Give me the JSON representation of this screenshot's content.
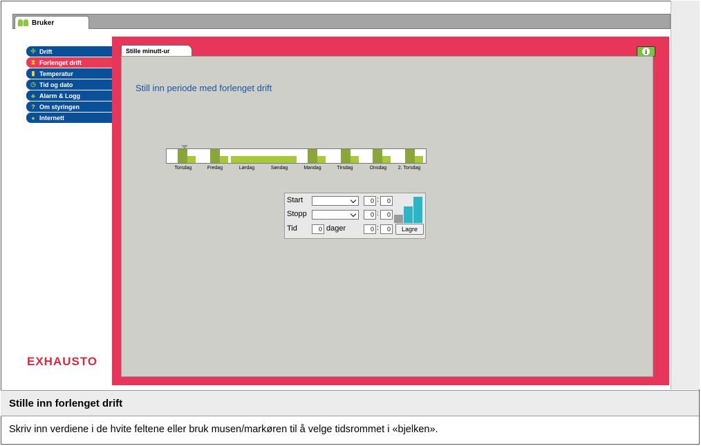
{
  "window": {
    "tab_label": "Bruker"
  },
  "sidebar": {
    "items": [
      {
        "label": "Drift",
        "icon": "fan-icon"
      },
      {
        "label": "Forlenget drift",
        "icon": "hourglass-icon"
      },
      {
        "label": "Temperatur",
        "icon": "thermometer-icon"
      },
      {
        "label": "Tid og dato",
        "icon": "clock-icon"
      },
      {
        "label": "Alarm & Logg",
        "icon": "bell-icon"
      },
      {
        "label": "Om styringen",
        "icon": "question-icon"
      },
      {
        "label": "Internett",
        "icon": "globe-icon"
      }
    ],
    "active_index": 1
  },
  "logo": "EXHAUSTO",
  "panel": {
    "tab_label": "Stille minutt-ur",
    "heading": "Still inn periode med forlenget drift"
  },
  "timeline": {
    "days": [
      "Torsdag",
      "Fredag",
      "Lørdag",
      "Søndag",
      "Mandag",
      "Tirsdag",
      "Onsdag",
      "2. Torsdag"
    ]
  },
  "form": {
    "start_label": "Start",
    "stopp_label": "Stopp",
    "tid_label": "Tid",
    "start_hour": "0",
    "start_min": "0",
    "stopp_hour": "0",
    "stopp_min": "0",
    "tid_days": "0",
    "dager_label": "dager",
    "tid_hour": "0",
    "tid_min": "0",
    "colon": ":",
    "save_label": "Lagre"
  },
  "colors": {
    "nav_blue": "#0a4f9a",
    "nav_active": "#ea3a5a",
    "panel_red": "#e8365b",
    "bar_green": "#a6c839",
    "bar_dark": "#8aa63a",
    "level_cyan": "#2bb6c6"
  },
  "footer": {
    "title": "Stille inn forlenget drift",
    "text": "Skriv inn verdiene i de hvite feltene eller bruk musen/markøren til å velge tidsrommet i «bjelken»."
  }
}
